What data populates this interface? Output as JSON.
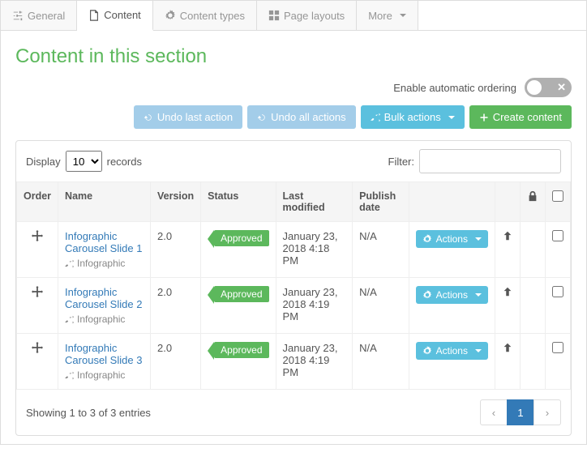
{
  "tabs": [
    {
      "label": "General"
    },
    {
      "label": "Content"
    },
    {
      "label": "Content types"
    },
    {
      "label": "Page layouts"
    },
    {
      "label": "More"
    }
  ],
  "page": {
    "title": "Content in this section"
  },
  "ordering": {
    "label": "Enable automatic ordering"
  },
  "actions": {
    "undo_last": "Undo last action",
    "undo_all": "Undo all actions",
    "bulk": "Bulk actions",
    "create": "Create content",
    "row_actions": "Actions"
  },
  "table": {
    "display_label": "Display",
    "page_size": "10",
    "records_label": "records",
    "filter_label": "Filter:",
    "columns": [
      "Order",
      "Name",
      "Version",
      "Status",
      "Last modified",
      "Publish date"
    ],
    "rows": [
      {
        "name": "Infographic Carousel Slide 1",
        "type": "Infographic",
        "version": "2.0",
        "status": "Approved",
        "modified": "January 23, 2018 4:18 PM",
        "publish": "N/A"
      },
      {
        "name": "Infographic Carousel Slide 2",
        "type": "Infographic",
        "version": "2.0",
        "status": "Approved",
        "modified": "January 23, 2018 4:19 PM",
        "publish": "N/A"
      },
      {
        "name": "Infographic Carousel Slide 3",
        "type": "Infographic",
        "version": "2.0",
        "status": "Approved",
        "modified": "January 23, 2018 4:19 PM",
        "publish": "N/A"
      }
    ],
    "showing": "Showing 1 to 3 of 3 entries",
    "pager": {
      "current": "1"
    }
  }
}
